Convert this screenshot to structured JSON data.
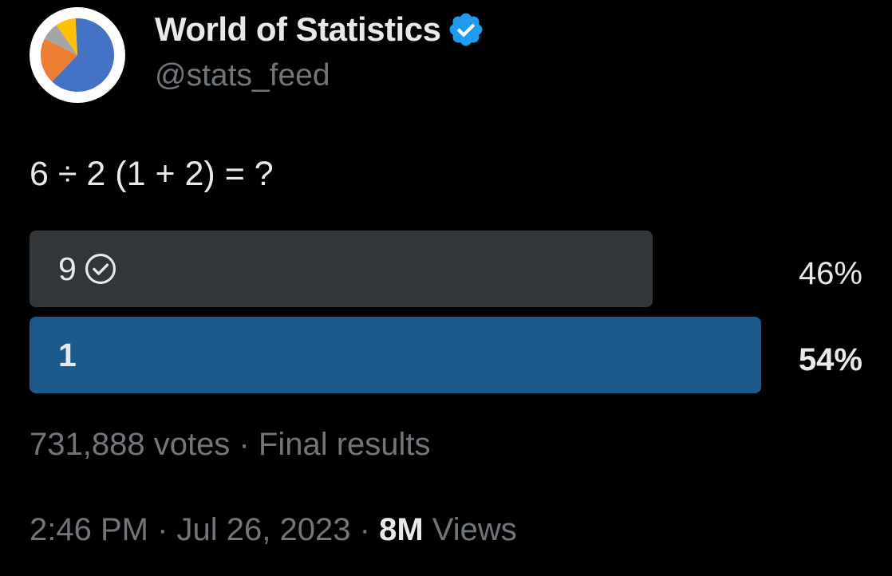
{
  "account": {
    "display_name": "World of Statistics",
    "handle": "@stats_feed",
    "avatar_icon": "pie-chart-icon",
    "verified_icon": "verified-badge-icon",
    "verified_color": "#1d9bf0"
  },
  "tweet": {
    "text": "6 ÷ 2 (1 + 2) = ?"
  },
  "poll": {
    "options": [
      {
        "label": "9",
        "percent_label": "46%",
        "percent": 46,
        "selected_by_user": true,
        "winner": false,
        "bar_color": "#333639"
      },
      {
        "label": "1",
        "percent_label": "54%",
        "percent": 54,
        "selected_by_user": false,
        "winner": true,
        "bar_color": "#1a5a8c"
      }
    ],
    "votes": "731,888 votes",
    "separator": "·",
    "status": "Final results"
  },
  "meta": {
    "time": "2:46 PM",
    "separator": "·",
    "date": "Jul 26, 2023",
    "views_count": "8M",
    "views_label": "Views"
  }
}
